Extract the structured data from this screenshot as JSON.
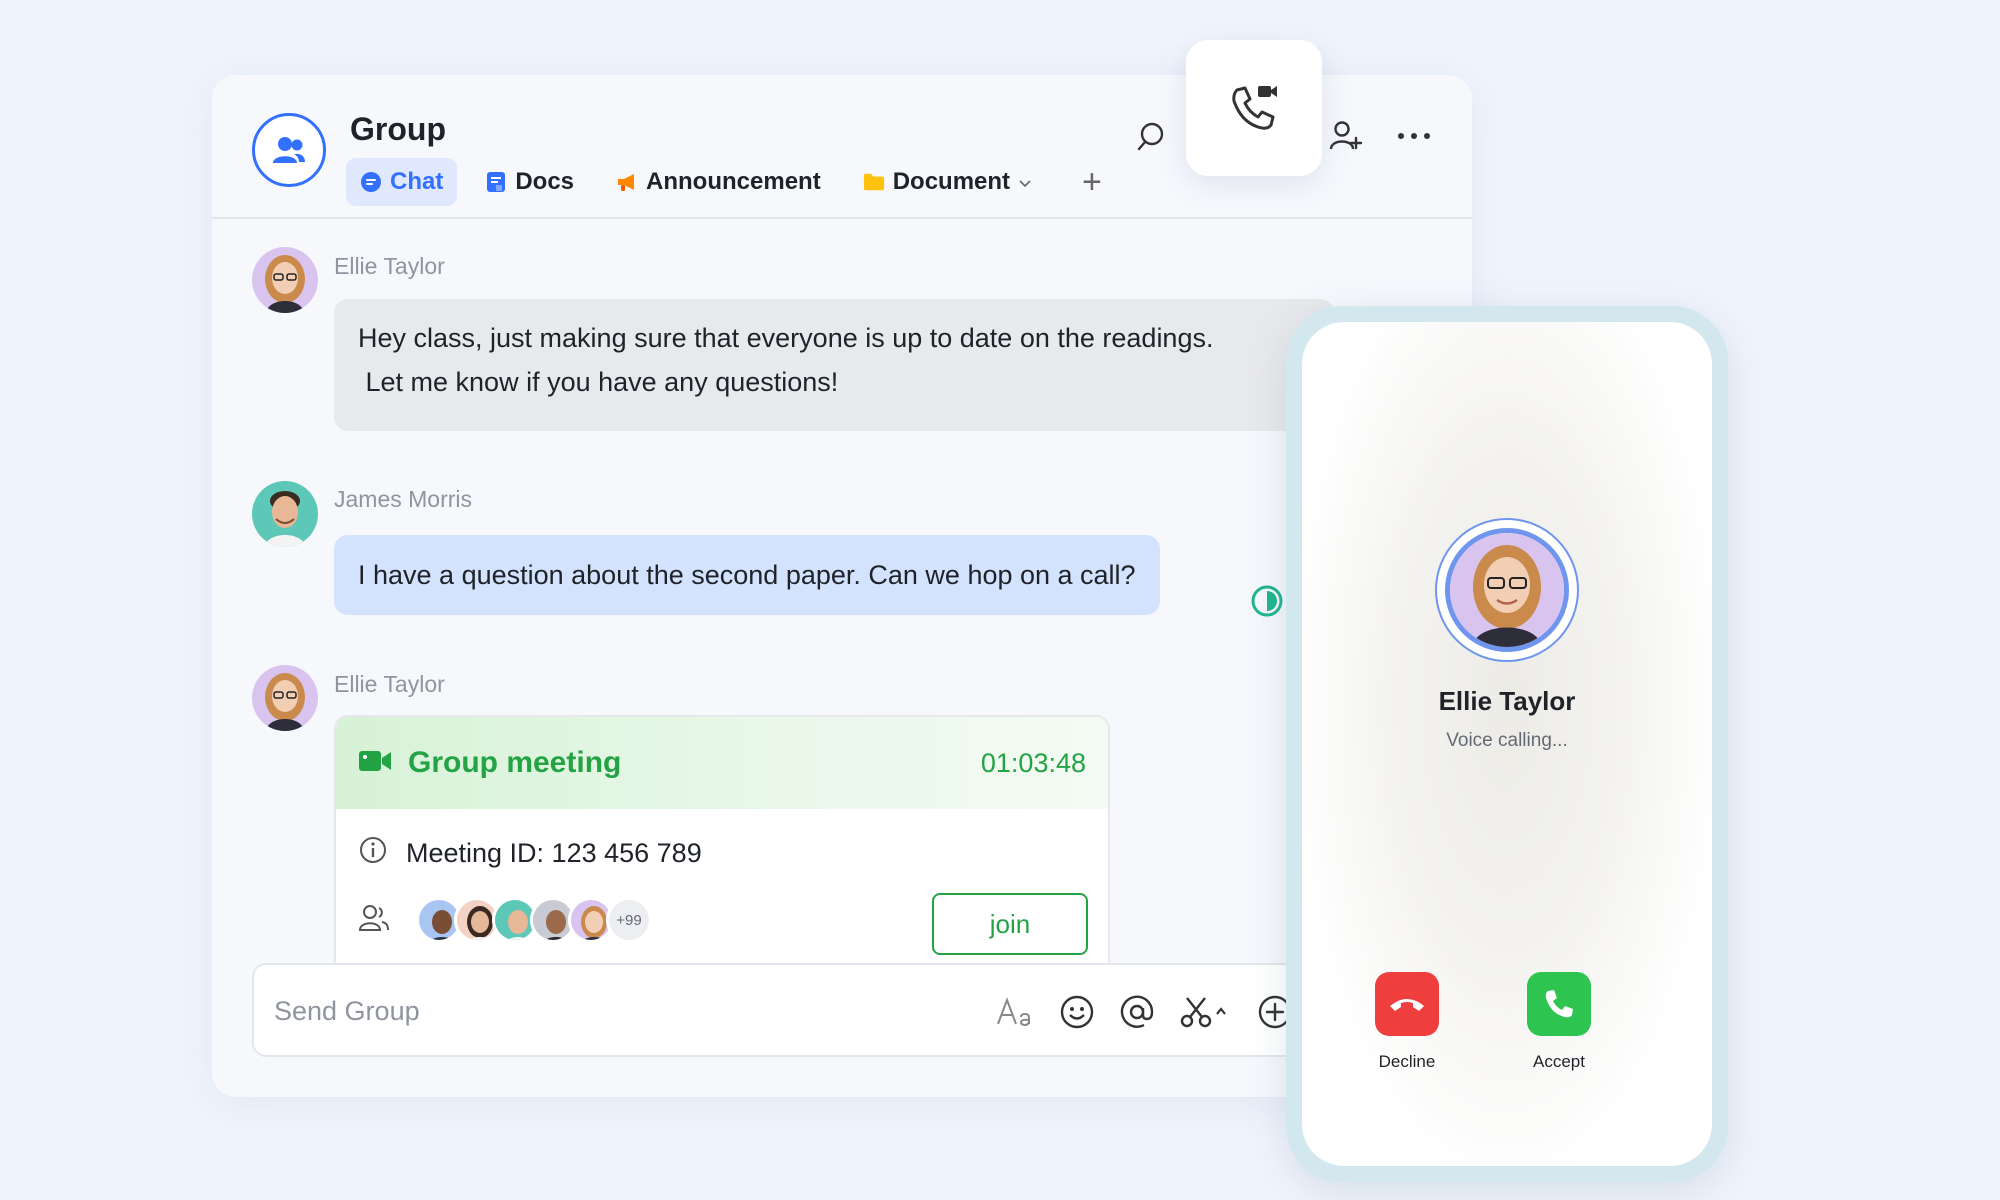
{
  "header": {
    "title": "Group",
    "tabs": [
      {
        "label": "Chat",
        "icon": "chat-bubble-icon",
        "active": true
      },
      {
        "label": "Docs",
        "icon": "docs-icon"
      },
      {
        "label": "Announcement",
        "icon": "megaphone-icon"
      },
      {
        "label": "Document",
        "icon": "folder-icon"
      }
    ],
    "add_tab": "+"
  },
  "messages": [
    {
      "sender": "Ellie Taylor",
      "lines": [
        "Hey class, just making sure that everyone is up to date on the readings.",
        " Let me know if you have any questions!"
      ]
    },
    {
      "sender": "James Morris",
      "text": "I have a question about the second paper. Can we hop on a call?"
    },
    {
      "sender": "Ellie Taylor"
    }
  ],
  "meeting": {
    "title": "Group meeting",
    "duration": "01:03:48",
    "id_text": "Meeting ID: 123 456 789",
    "more_participants": "+99",
    "join_label": "join"
  },
  "composer": {
    "placeholder": "Send Group"
  },
  "call": {
    "caller_name": "Ellie Taylor",
    "status": "Voice calling...",
    "decline_label": "Decline",
    "accept_label": "Accept"
  },
  "colors": {
    "accent": "#3370ff",
    "meeting_green": "#24a345",
    "decline_red": "#ef3e3e",
    "accept_green": "#2dc44f"
  }
}
